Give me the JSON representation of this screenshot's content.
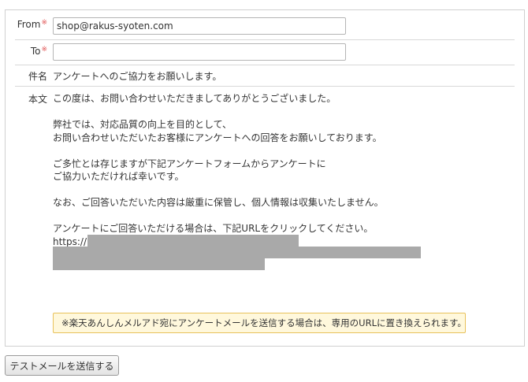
{
  "form": {
    "from": {
      "label": "From",
      "required_mark": "※",
      "value": "shop@rakus-syoten.com"
    },
    "to": {
      "label": "To",
      "required_mark": "※",
      "value": ""
    },
    "subject": {
      "label": "件名",
      "value": "アンケートへのご協力をお願いします。"
    },
    "body": {
      "label": "本文",
      "paragraphs": [
        [
          "この度は、お問い合わせいただきましてありがとうございました。"
        ],
        [
          "弊社では、対応品質の向上を目的として、",
          "お問い合わせいただいたお客様にアンケートへの回答をお願いしております。"
        ],
        [
          "ご多忙とは存じますが下記アンケートフォームからアンケートに",
          "ご協力いただければ幸いです。"
        ],
        [
          "なお、ご回答いただいた内容は厳重に保管し、個人情報は収集いたしません。"
        ],
        [
          "アンケートにご回答いただける場合は、下記URLをクリックしてください。",
          "https://"
        ]
      ]
    },
    "notice": "※楽天あんしんメルアド宛にアンケートメールを送信する場合は、専用のURLに置き換えられます。"
  },
  "actions": {
    "send_test_label": "テストメールを送信する"
  },
  "colors": {
    "notice_bg": "#fff8dc",
    "notice_border": "#e8c15a",
    "required": "#e05050",
    "redaction": "#a9a9a9"
  }
}
